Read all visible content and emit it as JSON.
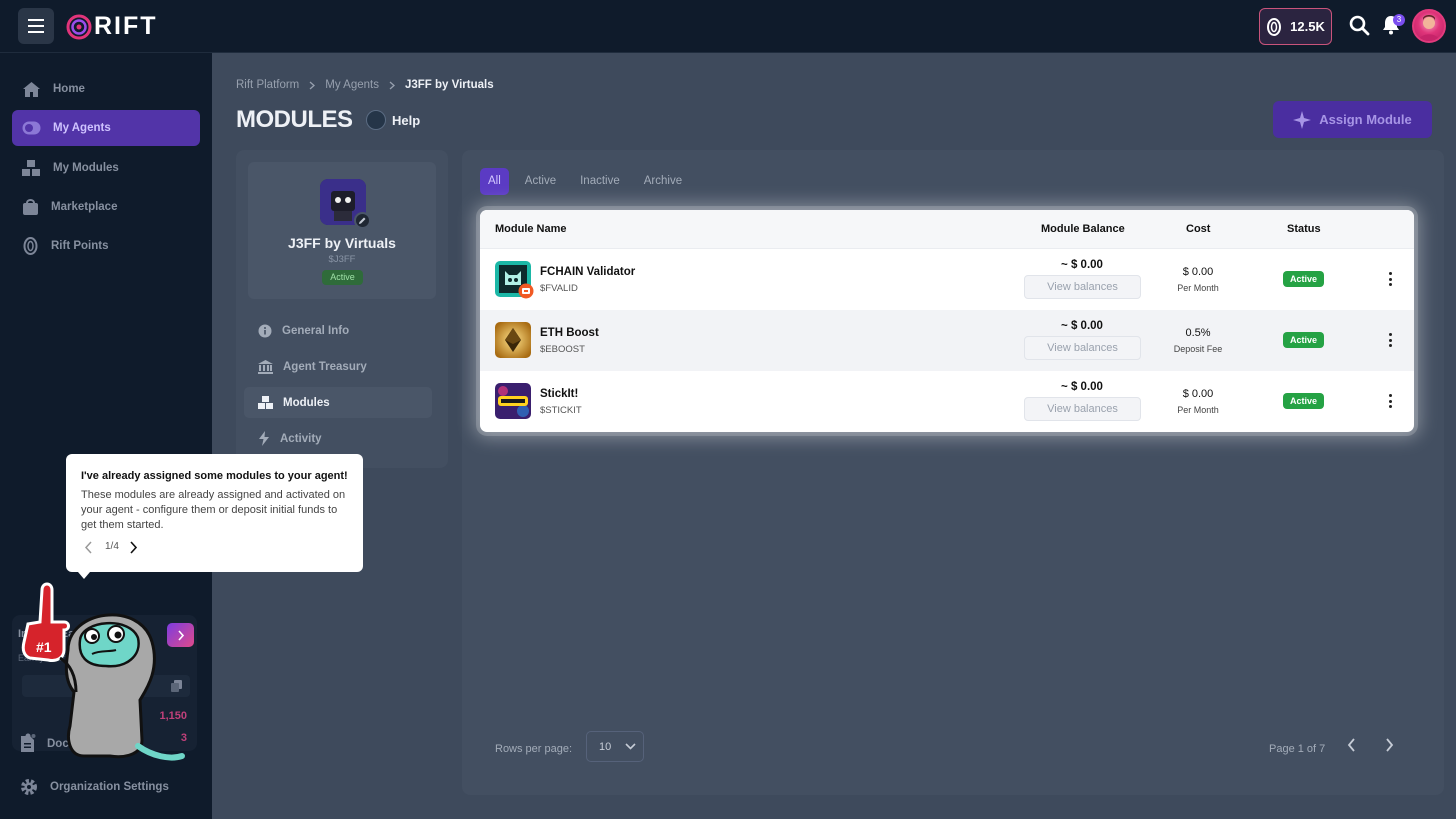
{
  "app": {
    "logo_text": "RIFT",
    "points_balance": "12.5K",
    "notifications_count": "3"
  },
  "sidebar": {
    "items": [
      {
        "label": "Home",
        "icon": "home-icon",
        "active": false
      },
      {
        "label": "My Agents",
        "icon": "agent-toggle-icon",
        "active": true
      },
      {
        "label": "My Modules",
        "icon": "cubes-icon",
        "active": false
      },
      {
        "label": "Marketplace",
        "icon": "shopping-bag-icon",
        "active": false
      },
      {
        "label": "Rift Points",
        "icon": "coin-icon",
        "active": false
      }
    ],
    "invite": {
      "title": "Invite & Earn Points",
      "subtitle": "Earn     your friends Points forever!",
      "earned_points": "1,150",
      "invited_count": "3"
    },
    "bottom": [
      {
        "label": "Documentation",
        "icon": "document-icon"
      },
      {
        "label": "Organization Settings",
        "icon": "gear-icon"
      }
    ]
  },
  "breadcrumb": [
    "Rift Platform",
    "My Agents",
    "J3FF by Virtuals"
  ],
  "header": {
    "title": "MODULES",
    "help_label": "Help",
    "assign_label": "Assign Module"
  },
  "agent": {
    "name": "J3FF by Virtuals",
    "ticker": "$J3FF",
    "status": "Active"
  },
  "agent_nav": [
    {
      "label": "General Info",
      "icon": "info-icon",
      "active": false
    },
    {
      "label": "Agent Treasury",
      "icon": "bank-icon",
      "active": false
    },
    {
      "label": "Modules",
      "icon": "cubes-icon",
      "active": true
    },
    {
      "label": "Activity",
      "icon": "lightning-icon",
      "active": false
    }
  ],
  "tabs": [
    {
      "label": "All",
      "active": true
    },
    {
      "label": "Active",
      "active": false
    },
    {
      "label": "Inactive",
      "active": false
    },
    {
      "label": "Archive",
      "active": false
    }
  ],
  "table": {
    "columns": {
      "name": "Module Name",
      "balance": "Module Balance",
      "cost": "Cost",
      "status": "Status"
    },
    "view_balances_label": "View balances",
    "rows": [
      {
        "name": "FCHAIN Validator",
        "ticker": "$FVALID",
        "balance": "~ $ 0.00",
        "cost": "$ 0.00",
        "cost_unit": "Per Month",
        "status": "Active"
      },
      {
        "name": "ETH Boost",
        "ticker": "$EBOOST",
        "balance": "~ $ 0.00",
        "cost": "0.5%",
        "cost_unit": "Deposit Fee",
        "status": "Active"
      },
      {
        "name": "StickIt!",
        "ticker": "$STICKIT",
        "balance": "~ $ 0.00",
        "cost": "$ 0.00",
        "cost_unit": "Per Month",
        "status": "Active"
      }
    ]
  },
  "pagination": {
    "rows_label": "Rows per page:",
    "rows_value": "10",
    "page_info": "Page 1 of 7"
  },
  "tooltip": {
    "title": "I've already assigned some modules to your agent!",
    "body": "These modules are already assigned and activated on your agent - configure them or deposit initial funds to get them started.",
    "step": "1/4"
  },
  "colors": {
    "accent": "#5b3bc4",
    "status_active": "#25a244",
    "background": "#0f1b2b"
  }
}
